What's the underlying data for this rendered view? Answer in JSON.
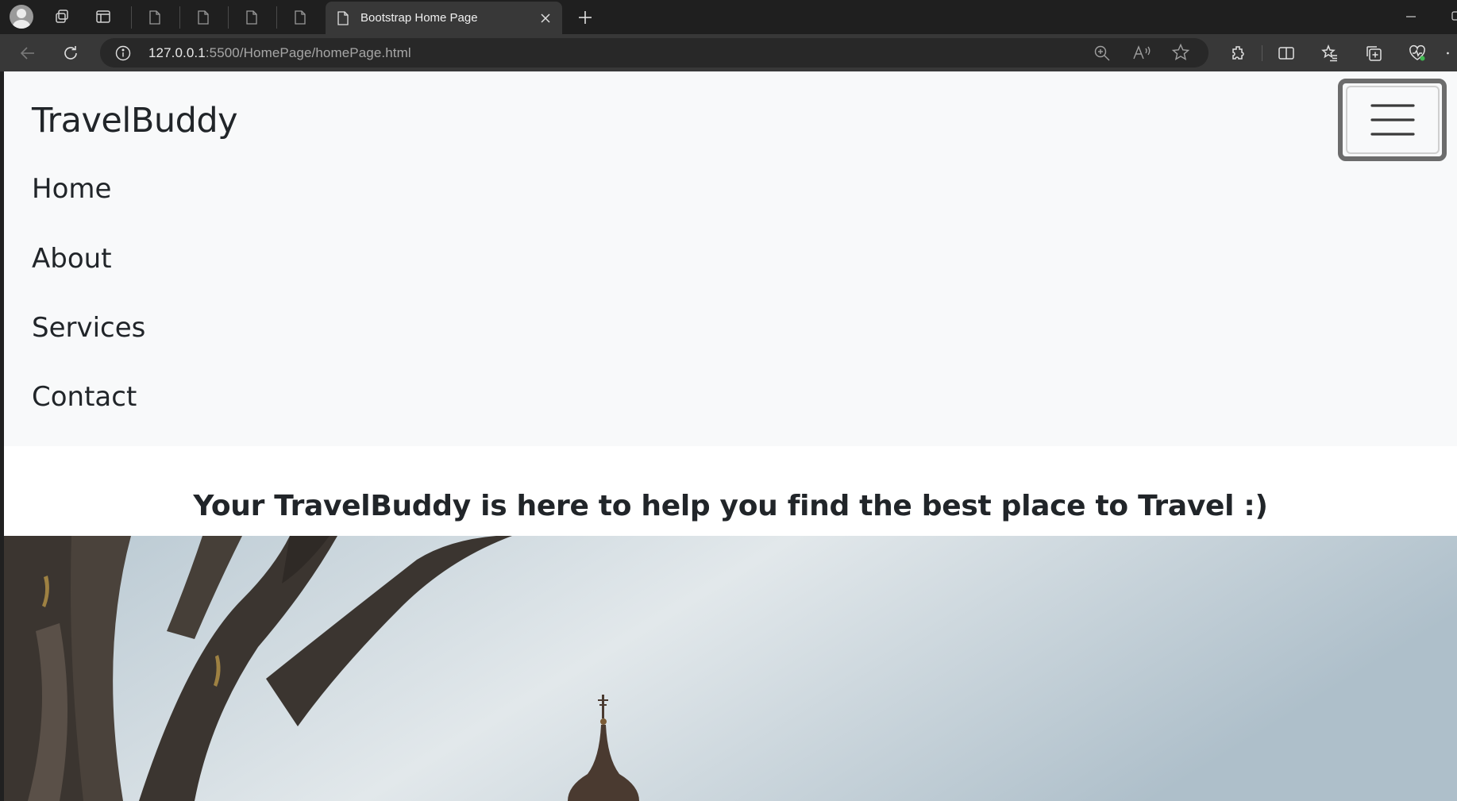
{
  "browser": {
    "tab_title": "Bootstrap Home Page",
    "url_host": "127.0.0.1",
    "url_rest": ":5500/HomePage/homePage.html"
  },
  "navbar": {
    "brand": "TravelBuddy",
    "links": [
      "Home",
      "About",
      "Services",
      "Contact"
    ]
  },
  "hero": {
    "tagline": "Your TravelBuddy is here to help you find the best place to Travel :)"
  }
}
